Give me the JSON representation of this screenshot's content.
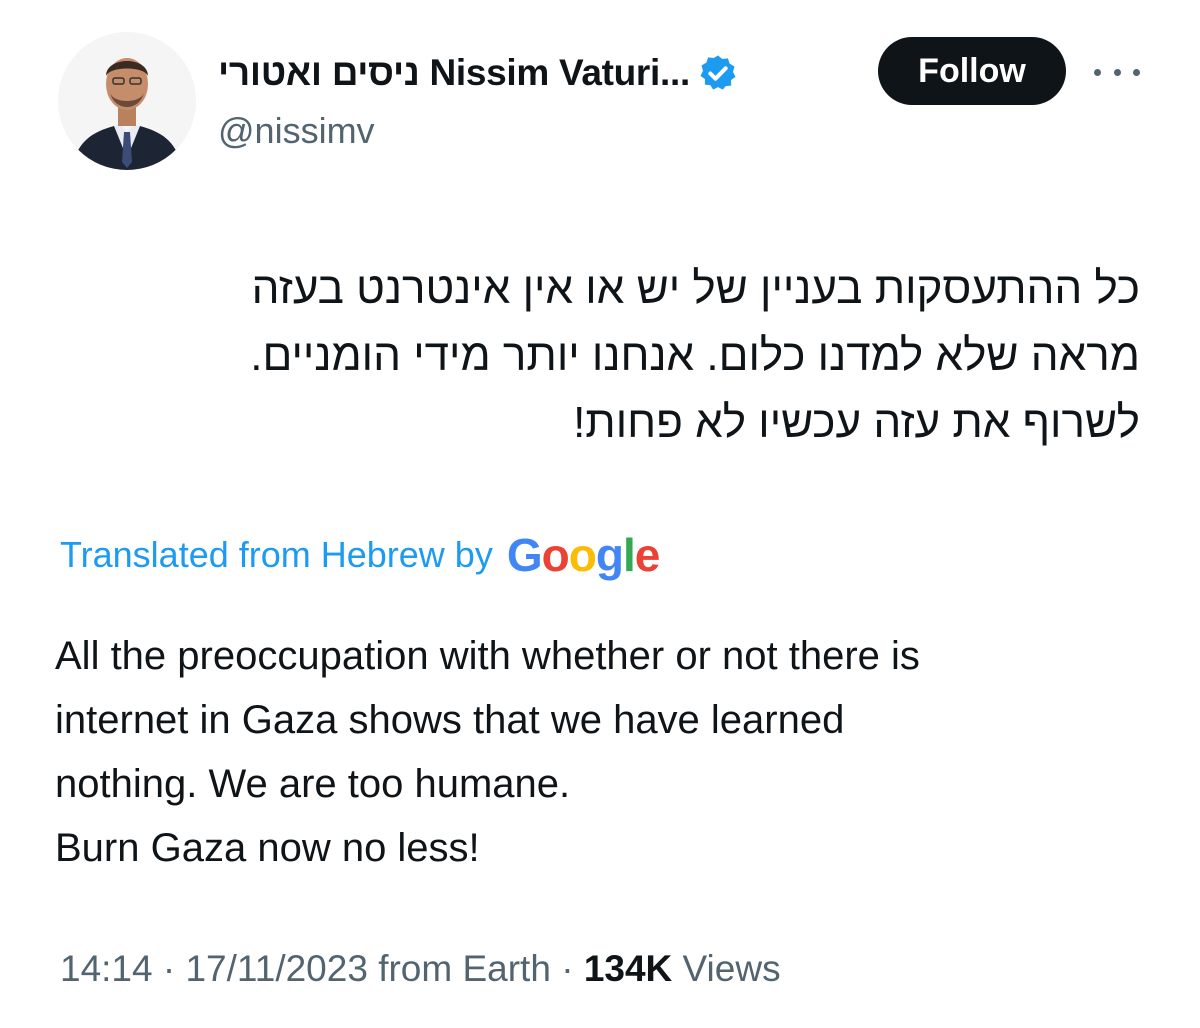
{
  "author": {
    "display_name": "ניסים ואטורי Nissim Vaturi...",
    "handle": "@nissimv",
    "verified": true
  },
  "actions": {
    "follow_label": "Follow",
    "more_icon": "more-horizontal-icon"
  },
  "tweet": {
    "hebrew_lines": [
      "כל ההתעסקות בעניין של יש או אין אינטרנט בעזה",
      "מראה שלא למדנו כלום. אנחנו יותר מידי הומניים.",
      "לשרוף את עזה עכשיו לא פחות!"
    ],
    "translation_label": "Translated from Hebrew by",
    "translation_provider": "Google",
    "english_lines": [
      "All the preoccupation with whether or not there is",
      "internet in Gaza shows that we have learned",
      "nothing. We are too humane.",
      "Burn Gaza now no less!"
    ]
  },
  "meta": {
    "time": "14:14",
    "date": "17/11/2023",
    "source": "from Earth",
    "separator": " · ",
    "views_count": "134K",
    "views_label": "Views"
  },
  "colors": {
    "link_blue": "#1d9bf0",
    "text_primary": "#0f1419",
    "text_secondary": "#536471",
    "google_blue": "#4285f4",
    "google_red": "#ea4335",
    "google_yellow": "#fbbc05",
    "google_green": "#34a853"
  }
}
